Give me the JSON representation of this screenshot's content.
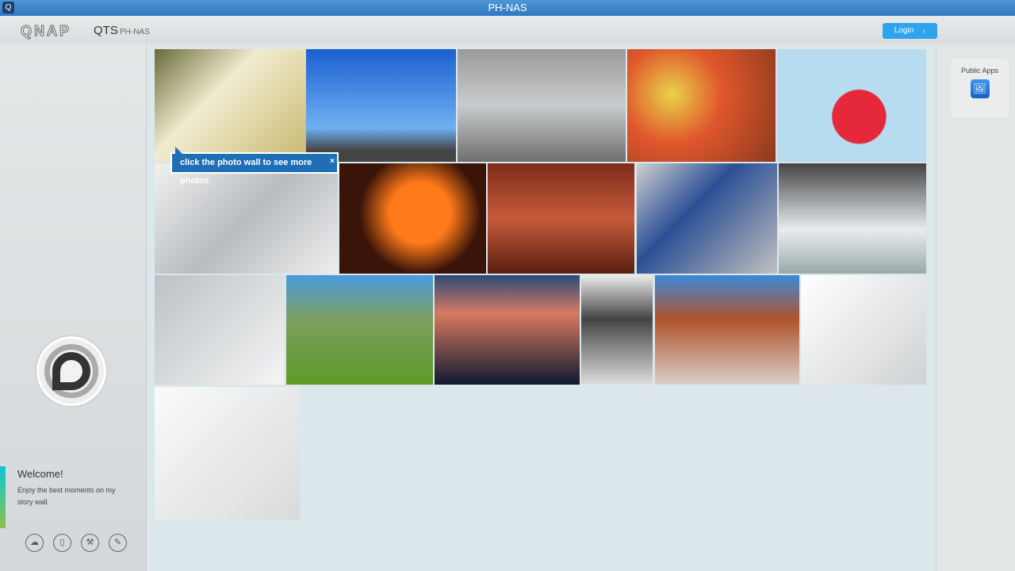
{
  "window": {
    "title": "PH-NAS"
  },
  "header": {
    "logo": "QNAP",
    "product": "QTS",
    "hostname": "PH-NAS",
    "login_label": "Login",
    "login_arrow": "↓"
  },
  "sidebar": {
    "welcome_title": "Welcome!",
    "welcome_text": "Enjoy the best moments on my story wall.",
    "tools": [
      {
        "icon": "cloud-icon",
        "glyph": "☁"
      },
      {
        "icon": "mobile-icon",
        "glyph": "▯"
      },
      {
        "icon": "hammer-icon",
        "glyph": "⚒"
      },
      {
        "icon": "pencil-icon",
        "glyph": "✎"
      }
    ]
  },
  "right_panel": {
    "public_apps_label": "Public Apps",
    "photo_icon": "🖼"
  },
  "photo_wall": {
    "tooltip": "click the photo wall to see more photos",
    "tooltip_close": "×"
  },
  "colors": {
    "accent": "#2ea4ef",
    "titlebar": "#2f78c2"
  }
}
